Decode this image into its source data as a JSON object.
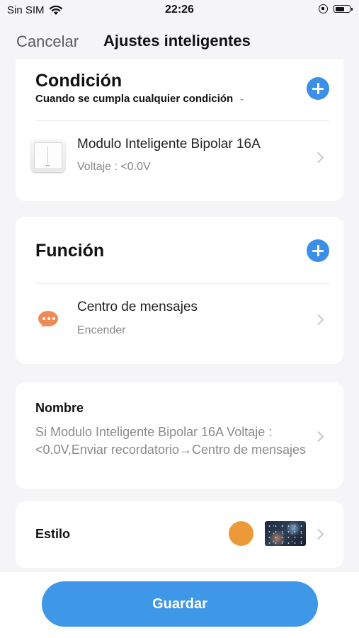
{
  "status": {
    "carrier": "Sin SIM",
    "time": "22:26",
    "icons": [
      "wifi-icon",
      "rotation-lock-icon",
      "battery-icon"
    ]
  },
  "nav": {
    "cancel_label": "Cancelar",
    "title": "Ajustes inteligentes"
  },
  "condition": {
    "title": "Condición",
    "mode": "Cuando se cumpla cualquier condición",
    "items": [
      {
        "name": "Modulo Inteligente Bipolar 16A",
        "detail": "Voltaje : <0.0V",
        "icon": "smart-module-icon"
      }
    ]
  },
  "function": {
    "title": "Función",
    "items": [
      {
        "name": "Centro de mensajes",
        "detail": "Encender",
        "icon": "message-center-icon"
      }
    ]
  },
  "name_section": {
    "label": "Nombre",
    "value": "Si Modulo Inteligente Bipolar 16A Voltaje : <0.0V,Enviar recordatorio→Centro de mensajes"
  },
  "style_section": {
    "label": "Estilo",
    "color": "#ee9938"
  },
  "footer": {
    "save_label": "Guardar"
  },
  "colors": {
    "accent": "#3f97e8",
    "message_icon": "#ee8b55"
  }
}
